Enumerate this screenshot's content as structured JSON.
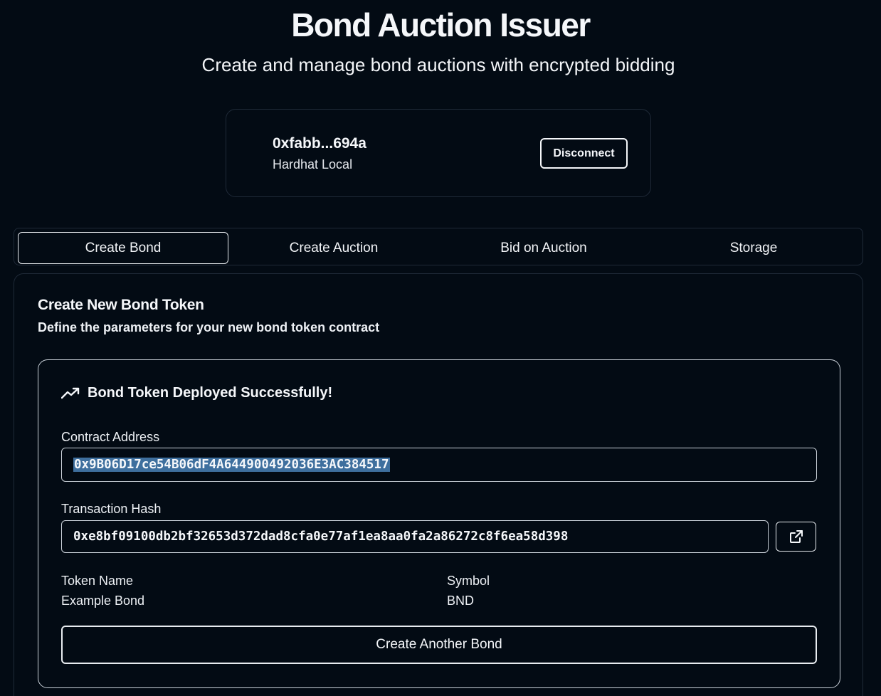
{
  "header": {
    "title": "Bond Auction Issuer",
    "subtitle": "Create and manage bond auctions with encrypted bidding"
  },
  "wallet": {
    "address": "0xfabb...694a",
    "network": "Hardhat Local",
    "disconnect_label": "Disconnect"
  },
  "tabs": [
    {
      "label": "Create Bond",
      "active": true
    },
    {
      "label": "Create Auction",
      "active": false
    },
    {
      "label": "Bid on Auction",
      "active": false
    },
    {
      "label": "Storage",
      "active": false
    }
  ],
  "create_bond": {
    "title": "Create New Bond Token",
    "description": "Define the parameters for your new bond token contract",
    "result": {
      "icon": "trending-up-icon",
      "title": "Bond Token Deployed Successfully!",
      "contract_address_label": "Contract Address",
      "contract_address": "0x9B06D17ce54B06dF4A644900492036E3AC384517",
      "tx_hash_label": "Transaction Hash",
      "tx_hash": "0xe8bf09100db2bf32653d372dad8cfa0e77af1ea8aa0fa2a86272c8f6ea58d398",
      "open_explorer_icon": "external-link-icon",
      "token_name_label": "Token Name",
      "token_name": "Example Bond",
      "symbol_label": "Symbol",
      "symbol": "BND",
      "create_another_label": "Create Another Bond"
    }
  },
  "colors": {
    "background": "#030b14",
    "border": "#1f2a38",
    "selection": "#3e6f9e"
  }
}
